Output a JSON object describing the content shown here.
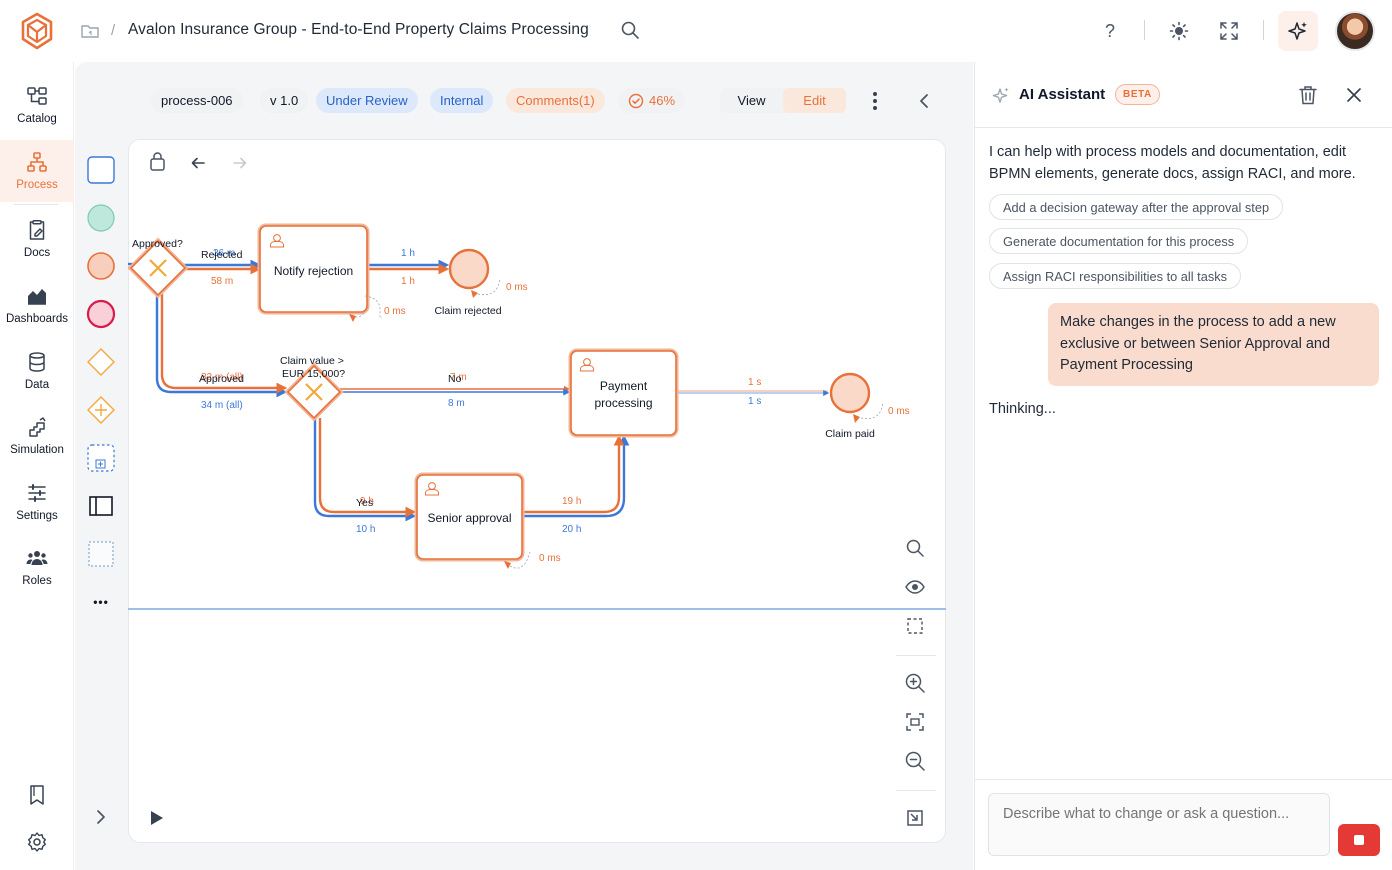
{
  "header": {
    "title": "Avalon Insurance Group - End-to-End Property Claims Processing",
    "help_label": "?"
  },
  "nav": {
    "items": [
      {
        "label": "Catalog",
        "icon": "catalog-icon"
      },
      {
        "label": "Process",
        "icon": "process-icon",
        "active": true
      },
      {
        "label": "Docs",
        "icon": "docs-icon"
      },
      {
        "label": "Dashboards",
        "icon": "dashboards-icon"
      },
      {
        "label": "Data",
        "icon": "data-icon"
      },
      {
        "label": "Simulation",
        "icon": "simulation-icon"
      },
      {
        "label": "Settings",
        "icon": "settings-icon"
      },
      {
        "label": "Roles",
        "icon": "roles-icon"
      }
    ],
    "more_label": "•••"
  },
  "process": {
    "id": "process-006",
    "version": "v 1.0",
    "status": "Under Review",
    "visibility": "Internal",
    "comments": "Comments(1)",
    "progress": "46%",
    "view_label": "View",
    "edit_label": "Edit"
  },
  "diagram": {
    "gateway1_label": "Approved?",
    "rejected_label": "Rejected",
    "rejected_time_a": "36 m",
    "rejected_time_b": "58 m",
    "approved_label": "Approved",
    "approved_time_a": "32 m (all)",
    "approved_time_b": "34 m (all)",
    "task_notify": "Notify rejection",
    "notify_time_a": "1 h",
    "notify_time_b": "1 h",
    "notify_wait": "0 ms",
    "end_rejected": "Claim rejected",
    "end_rejected_wait": "0 ms",
    "gateway2_label_1": "Claim value >",
    "gateway2_label_2": "EUR 15,000?",
    "no_label": "No",
    "no_time_a": "7 m",
    "no_time_b": "8 m",
    "task_payment_1": "Payment",
    "task_payment_2": "processing",
    "payment_time_a": "1 s",
    "payment_time_b": "1 s",
    "end_paid": "Claim paid",
    "end_paid_wait": "0 ms",
    "yes_label": "Yes",
    "yes_time_a": "9 h",
    "yes_time_b": "10 h",
    "task_senior": "Senior approval",
    "senior_time_a": "19 h",
    "senior_time_b": "20 h",
    "senior_wait": "0 ms"
  },
  "ai": {
    "title": "AI Assistant",
    "badge": "BETA",
    "intro": "I can help with process models and documentation, edit BPMN elements, generate docs, assign RACI, and more.",
    "suggestions": [
      "Add a decision gateway after the approval step",
      "Generate documentation for this process",
      "Assign RACI responsibilities to all tasks"
    ],
    "user_message": "Make changes in the process to add a new exclusive or between Senior Approval and Payment Processing",
    "status": "Thinking...",
    "input_placeholder": "Describe what to change or ask a question..."
  },
  "colors": {
    "accent": "#e8713a",
    "flow_blue": "#3b78d8",
    "flow_orange": "#e8713a",
    "end_fill": "#fbd9c8",
    "stop": "#e53935"
  }
}
